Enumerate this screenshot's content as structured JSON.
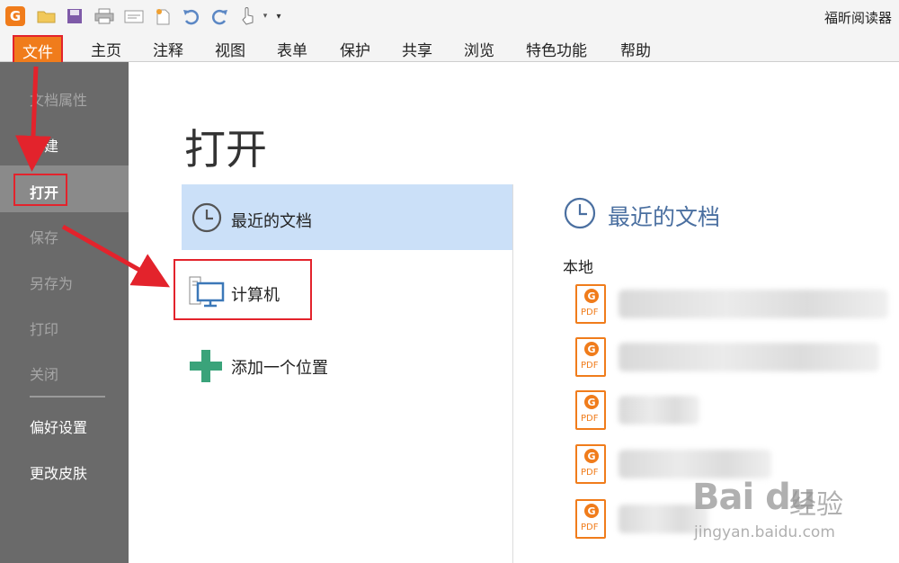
{
  "window": {
    "app_title": "福昕阅读器",
    "logo_glyph": "G"
  },
  "menu": {
    "file": "文件",
    "items": [
      "主页",
      "注释",
      "视图",
      "表单",
      "保护",
      "共享",
      "浏览",
      "特色功能",
      "帮助"
    ]
  },
  "sidebar": {
    "items": [
      "文档属性",
      "创建",
      "打开",
      "保存",
      "另存为",
      "打印",
      "关闭",
      "偏好设置",
      "更改皮肤"
    ],
    "selected": "打开"
  },
  "main": {
    "title": "打开",
    "options": [
      "最近的文档",
      "计算机",
      "添加一个位置"
    ]
  },
  "recent": {
    "title": "最近的文档",
    "section_label": "本地",
    "file_icon_label": "PDF",
    "file_icon_glyph": "G"
  },
  "watermark": {
    "logo": "Bai du",
    "jingyan": "经验",
    "url": "jingyan.baidu.com"
  },
  "colors": {
    "brand": "#f07c1b",
    "highlight": "#e3232c",
    "sidebar_bg": "#6a6a6a",
    "selected_option": "#cbe0f8",
    "accent_text": "#4a6fa0"
  }
}
